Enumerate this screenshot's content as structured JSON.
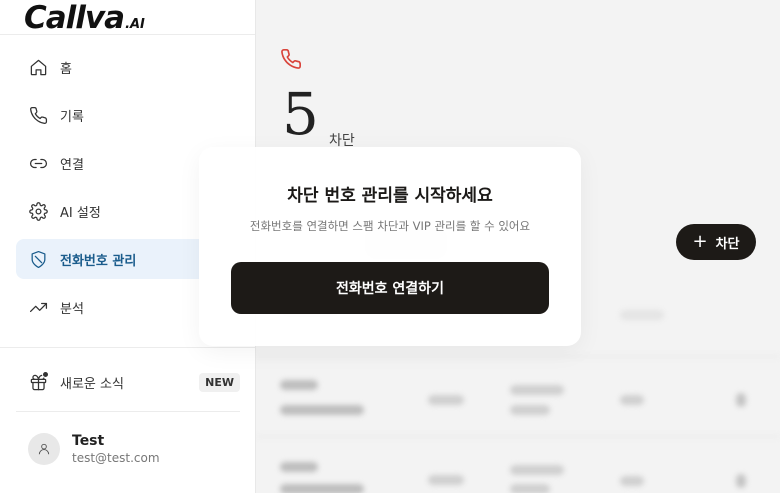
{
  "logo": {
    "main": "Callva",
    "suffix": ".AI"
  },
  "nav": {
    "items": [
      {
        "label": "홈",
        "icon": "home-icon"
      },
      {
        "label": "기록",
        "icon": "phone-icon"
      },
      {
        "label": "연결",
        "icon": "link-icon"
      },
      {
        "label": "AI 설정",
        "icon": "gear-icon"
      },
      {
        "label": "전화번호 관리",
        "icon": "shield-icon",
        "active": true
      },
      {
        "label": "분석",
        "icon": "trending-up-icon"
      }
    ]
  },
  "news": {
    "label": "새로운 소식",
    "badge": "NEW",
    "icon": "gift-icon"
  },
  "user": {
    "name": "Test",
    "email": "test@test.com"
  },
  "main": {
    "count": "5",
    "count_unit": "차단",
    "block_button_label": "차단",
    "accent_color": "#d9443b"
  },
  "modal": {
    "title": "차단 번호 관리를 시작하세요",
    "subtitle": "전화번호를 연결하면 스팸 차단과 VIP 관리를 할 수 있어요",
    "button_label": "전화번호 연결하기"
  }
}
